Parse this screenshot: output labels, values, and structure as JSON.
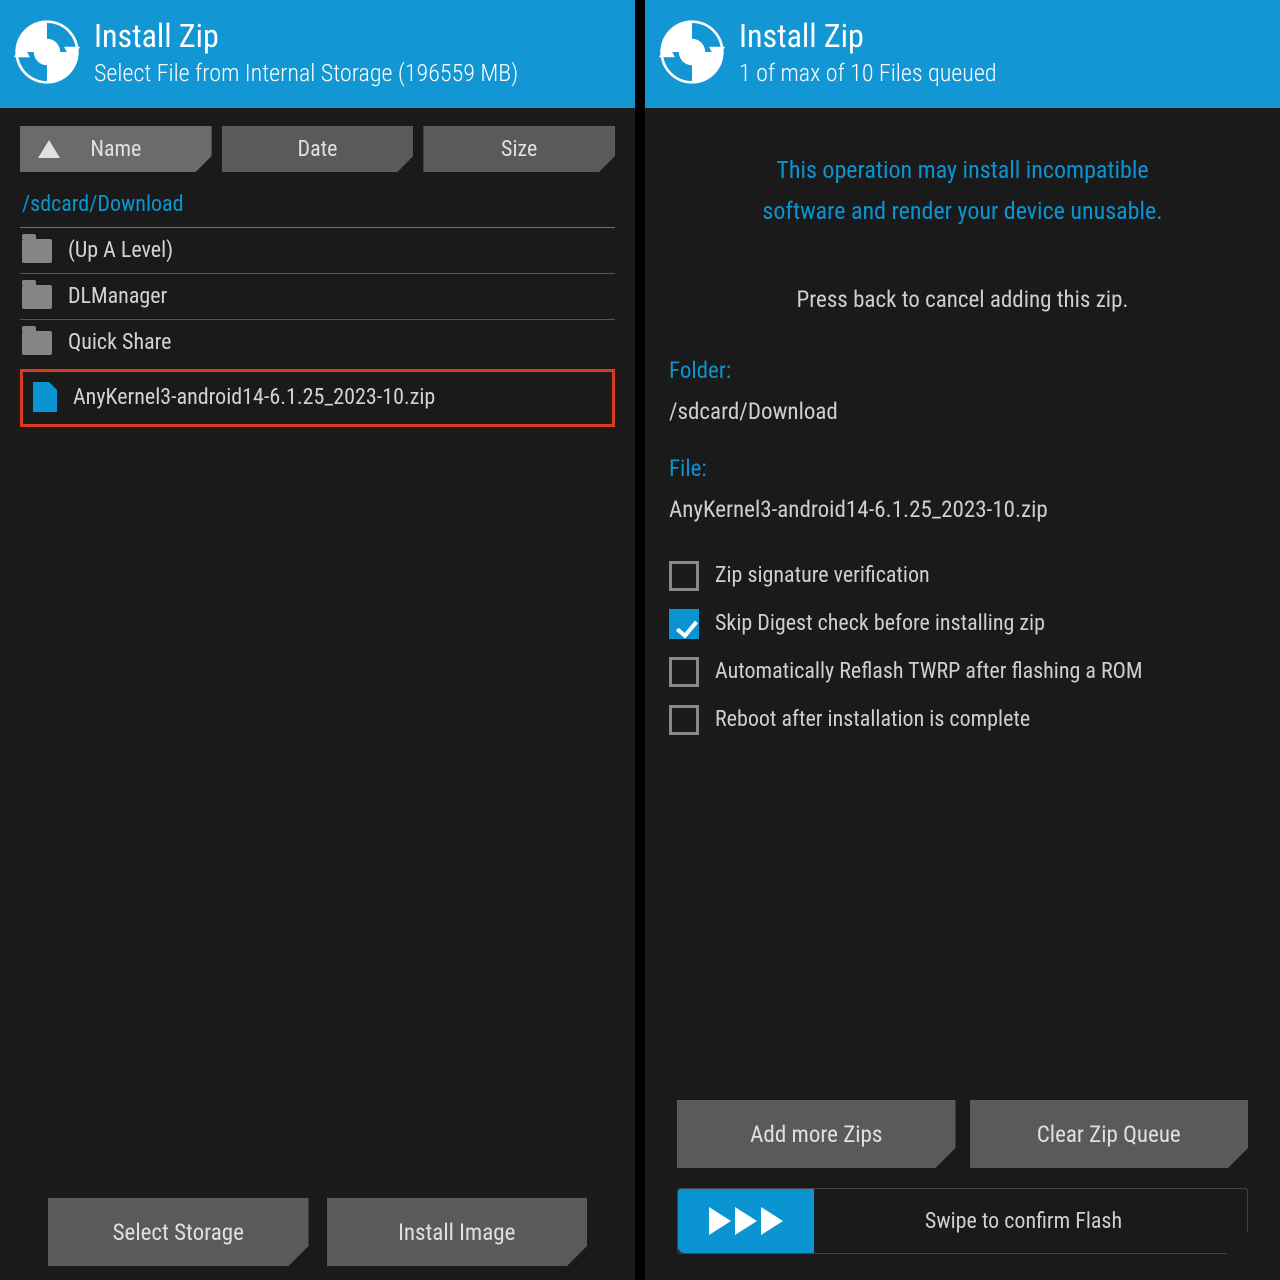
{
  "colors": {
    "accent": "#0a95d2",
    "header": "#1397d4",
    "highlight": "#d63b1f"
  },
  "left": {
    "title": "Install Zip",
    "subtitle": "Select File from Internal Storage (196559 MB)",
    "sort": {
      "name": "Name",
      "date": "Date",
      "size": "Size"
    },
    "path": "/sdcard/Download",
    "entries": {
      "up": "(Up A Level)",
      "dlmanager": "DLManager",
      "quickshare": "Quick Share",
      "zipfile": "AnyKernel3-android14-6.1.25_2023-10.zip"
    },
    "buttons": {
      "select_storage": "Select Storage",
      "install_image": "Install Image"
    }
  },
  "right": {
    "title": "Install Zip",
    "subtitle": "1 of max of 10 Files queued",
    "warning_line1": "This operation may install incompatible",
    "warning_line2": "software and render your device unusable.",
    "cancel_hint": "Press back to cancel adding this zip.",
    "folder_label": "Folder:",
    "folder_value": "/sdcard/Download",
    "file_label": "File:",
    "file_value": "AnyKernel3-android14-6.1.25_2023-10.zip",
    "checks": {
      "sig": "Zip signature verification",
      "digest": "Skip Digest check before installing zip",
      "reflash": "Automatically Reflash TWRP after flashing a ROM",
      "reboot": "Reboot after installation is complete"
    },
    "buttons": {
      "add": "Add more Zips",
      "clear": "Clear Zip Queue"
    },
    "swipe": "Swipe to confirm Flash"
  }
}
